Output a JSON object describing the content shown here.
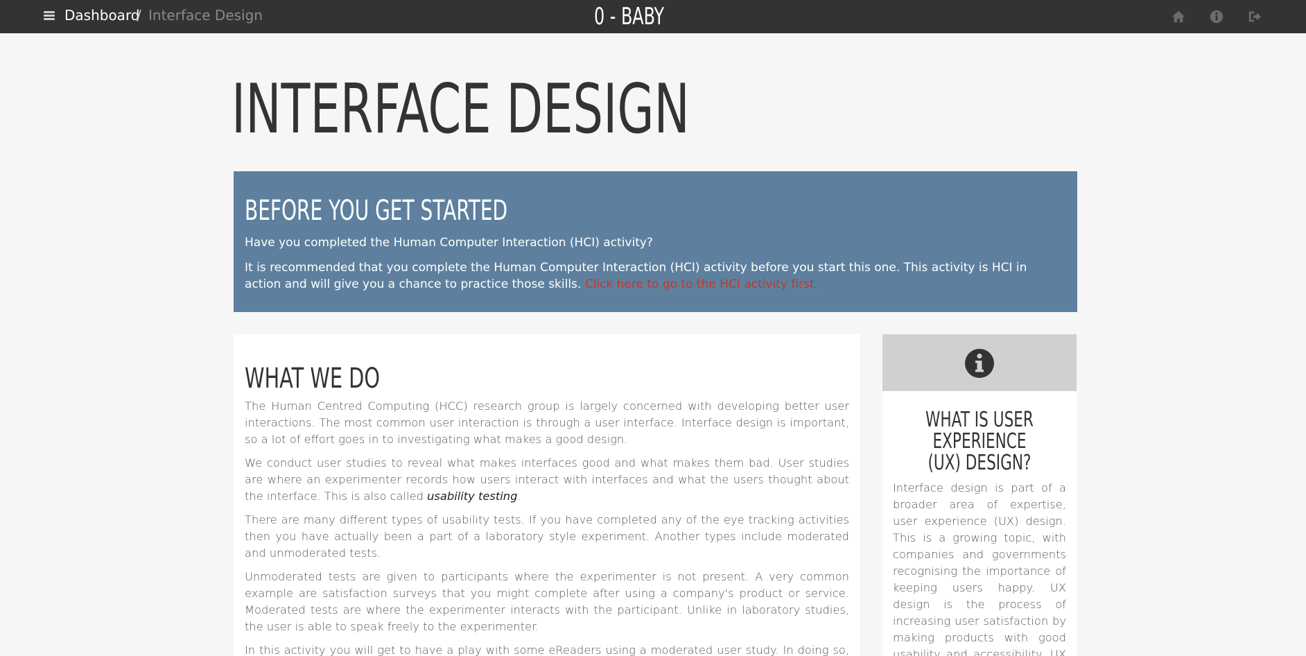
{
  "topbar": {
    "menu_icon": "bars-icon",
    "breadcrumb": {
      "home": "Dashboard",
      "separator": "/",
      "current": "Interface Design"
    },
    "brand": "0 - BABY",
    "icons": [
      "home-icon",
      "info-circle-icon",
      "sign-out-icon"
    ]
  },
  "page": {
    "title": "INTERFACE DESIGN"
  },
  "banner": {
    "heading": "BEFORE YOU GET STARTED",
    "question": "Have you completed the Human Computer Interaction (HCI) activity?",
    "recommendation": "It is recommended that you complete the Human Computer Interaction (HCI) activity before you start this one. This activity is HCI in action and will give you a chance to practice those skills.",
    "link_text": "Click here to go to the HCI activity first.",
    "background_color": "#5e809e",
    "link_color": "#c0392b"
  },
  "main": {
    "heading": "WHAT WE DO",
    "p1": "The Human Centred Computing (HCC) research group is largely concerned with developing better user interactions. The most common user interaction is through a user interface. Interface design is important, so a lot of effort goes in to investigating what makes a good design.",
    "p2_before": "We conduct user studies to reveal what makes interfaces good and what makes them bad. User studies are where an experimenter records how users interact with interfaces and what the users thought about the interface. This is also called ",
    "p2_term": "usability testing",
    "p2_after": ".",
    "p3": "There are many different types of usability tests. If you have completed any of the eye tracking activities then you have actually been a part of a laboratory style experiment. Another types include moderated and unmoderated tests.",
    "p4": "Unmoderated tests are given to participants where the experimenter is not present. A very common example are satisfaction surveys that you might complete after using a company's product or service. Moderated tests are where the experimenter interacts with the participant. Unlike in laboratory studies, the user is able to speak freely to the experimenter.",
    "p5": "In this activity you will get to have a play with some eReaders using a moderated user study. In doing so, you will"
  },
  "sidebar": {
    "icon": "info-circle-icon",
    "heading": "WHAT IS USER EXPERIENCE (UX) DESIGN?",
    "text": "Interface design is part of a broader area of expertise, user experience (UX) design. This is a growing topic, with companies and governments recognising the importance of keeping users happy. UX design is the process of increasing user satisfaction by making products with good usability and accessibility. UX design uses HCI, but goes"
  }
}
